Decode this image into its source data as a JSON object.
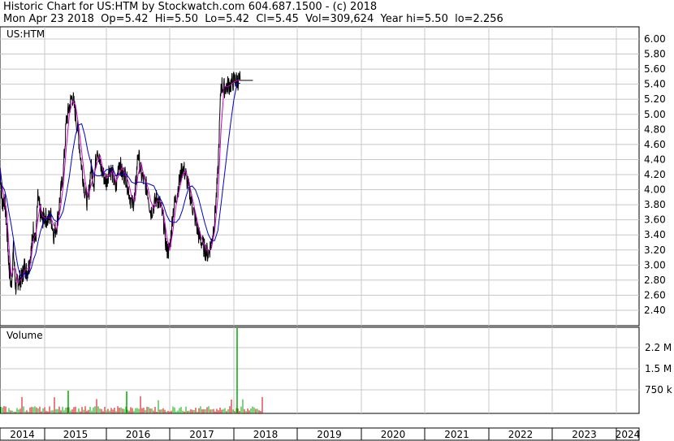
{
  "header": {
    "title": "Historic Chart for US:HTM by Stockwatch.com 604.687.1500 - (c) 2018",
    "quote": "Mon Apr 23 2018  Op=5.42  Hi=5.50  Lo=5.42  Cl=5.45  Vol=309,624  Year hi=5.50  lo=2.256"
  },
  "price_panel": {
    "symbol_label": "US:HTM",
    "y_ticks": [
      "6.00",
      "5.80",
      "5.60",
      "5.40",
      "5.20",
      "5.00",
      "4.80",
      "4.60",
      "4.40",
      "4.20",
      "4.00",
      "3.80",
      "3.60",
      "3.40",
      "3.20",
      "3.00",
      "2.80",
      "2.60",
      "2.40"
    ]
  },
  "volume_panel": {
    "label": "Volume",
    "y_ticks": [
      "2.2 M",
      "1.5 M",
      "750 k"
    ]
  },
  "x_axis": {
    "years": [
      "2014",
      "2015",
      "2016",
      "2017",
      "2018",
      "2019",
      "2020",
      "2021",
      "2022",
      "2023",
      "2024"
    ]
  },
  "colors": {
    "price": "#000000",
    "ma_short": "#cc00cc",
    "ma_long": "#0000cc",
    "vol_up": "#00aa00",
    "vol_down": "#cc0000",
    "grid": "#c8c8c8"
  },
  "chart_data": {
    "type": "line",
    "title": "Historic Chart for US:HTM",
    "ylim": [
      2.2,
      6.1
    ],
    "series": [
      {
        "name": "US:HTM",
        "x": [
          2014.0,
          2014.05,
          2014.1,
          2014.15,
          2014.2,
          2014.25,
          2014.3,
          2014.35,
          2014.4,
          2014.45,
          2014.5,
          2014.55,
          2014.6,
          2014.65,
          2014.7,
          2014.75,
          2014.8,
          2014.85,
          2014.9,
          2014.95,
          2015.0,
          2015.05,
          2015.1,
          2015.15,
          2015.2,
          2015.25,
          2015.3,
          2015.35,
          2015.4,
          2015.45,
          2015.5,
          2015.55,
          2015.6,
          2015.65,
          2015.7,
          2015.75,
          2015.8,
          2015.85,
          2015.9,
          2015.95,
          2016.0,
          2016.05,
          2016.1,
          2016.15,
          2016.2,
          2016.25,
          2016.3,
          2016.35,
          2016.4,
          2016.45,
          2016.5,
          2016.55,
          2016.6,
          2016.65,
          2016.7,
          2016.75,
          2016.8,
          2016.85,
          2016.9,
          2016.95,
          2017.0,
          2017.05,
          2017.1,
          2017.15,
          2017.2,
          2017.25,
          2017.3,
          2017.35,
          2017.4,
          2017.45,
          2017.5,
          2017.55,
          2017.6,
          2017.65,
          2017.7,
          2017.75,
          2017.8,
          2017.85,
          2017.9,
          2017.95,
          2018.0,
          2018.05,
          2018.1,
          2018.15,
          2018.2,
          2018.25,
          2018.3
        ],
        "values": [
          4.3,
          3.8,
          3.9,
          3.5,
          3.0,
          2.7,
          3.2,
          2.7,
          2.8,
          2.8,
          2.85,
          3.0,
          2.9,
          3.0,
          3.2,
          3.5,
          3.3,
          3.9,
          3.7,
          3.6,
          3.65,
          3.6,
          3.65,
          3.4,
          3.55,
          3.9,
          4.2,
          4.9,
          5.1,
          5.25,
          5.0,
          4.7,
          4.3,
          4.0,
          3.8,
          4.3,
          4.1,
          4.6,
          4.3,
          4.2,
          4.1,
          4.3,
          4.2,
          4.0,
          4.4,
          4.2,
          4.2,
          4.0,
          3.8,
          3.9,
          4.5,
          4.2,
          4.1,
          4.0,
          3.7,
          3.8,
          3.9,
          3.8,
          3.6,
          3.2,
          3.2,
          3.7,
          3.9,
          4.1,
          4.3,
          4.2,
          4.0,
          3.8,
          3.6,
          3.4,
          3.3,
          3.2,
          3.15,
          3.3,
          3.6,
          4.2,
          5.4,
          5.35,
          5.38,
          5.4,
          5.45,
          5.45,
          5.45,
          5.45,
          5.45,
          5.45,
          5.45
        ]
      }
    ]
  }
}
